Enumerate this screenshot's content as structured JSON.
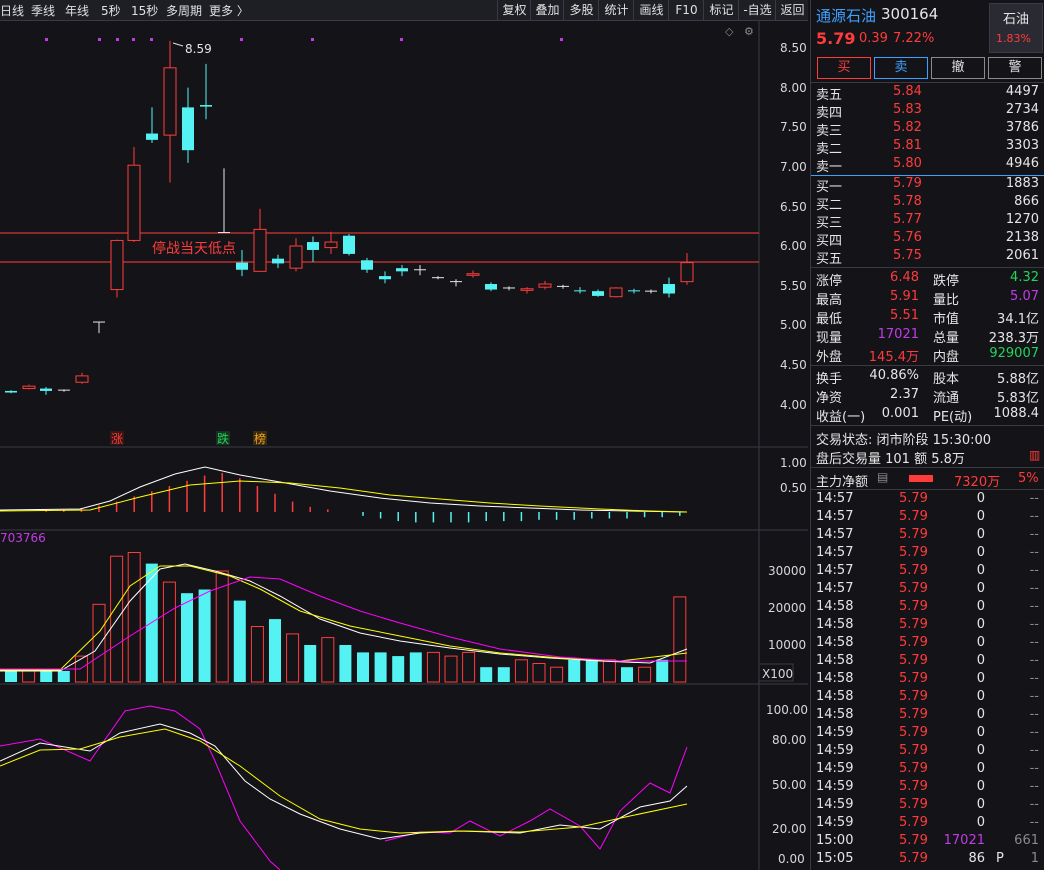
{
  "toolbar": {
    "periods": [
      "日线",
      "季线",
      "年线",
      "5秒",
      "15秒",
      "多周期",
      "更多 〉"
    ],
    "buttons": [
      "复权",
      "叠加",
      "多股",
      "统计",
      "画线",
      "F10",
      "标记",
      "-自选",
      "返回"
    ]
  },
  "main_chart": {
    "price_ticks": [
      "8.50",
      "8.00",
      "7.50",
      "7.00",
      "6.50",
      "6.00",
      "5.50",
      "5.00",
      "4.50",
      "4.00"
    ],
    "high_label": "8.59",
    "annotation": "停战当天低点",
    "event_markers": [
      "涨",
      "跌",
      "榜"
    ]
  },
  "indicator1": {
    "ticks": [
      "1.00",
      "0.50"
    ]
  },
  "volume_panel": {
    "header_value": "703766",
    "ticks": [
      "30000",
      "20000",
      "10000"
    ],
    "unit": "X100"
  },
  "indicator3": {
    "ticks": [
      "100.00",
      "80.00",
      "50.00",
      "20.00",
      "0.00"
    ]
  },
  "quote": {
    "name": "通源石油",
    "code": "300164",
    "sector": "石油",
    "sector_change": "1.83%",
    "price": "5.79",
    "change": "0.39",
    "change_pct": "7.22%",
    "trade_buttons": [
      "买",
      "卖",
      "撤",
      "警"
    ],
    "asks": [
      {
        "label": "卖五",
        "price": "5.84",
        "vol": "4497"
      },
      {
        "label": "卖四",
        "price": "5.83",
        "vol": "2734"
      },
      {
        "label": "卖三",
        "price": "5.82",
        "vol": "3786"
      },
      {
        "label": "卖二",
        "price": "5.81",
        "vol": "3303"
      },
      {
        "label": "卖一",
        "price": "5.80",
        "vol": "4946"
      }
    ],
    "bids": [
      {
        "label": "买一",
        "price": "5.79",
        "vol": "1883"
      },
      {
        "label": "买二",
        "price": "5.78",
        "vol": "866"
      },
      {
        "label": "买三",
        "price": "5.77",
        "vol": "1270"
      },
      {
        "label": "买四",
        "price": "5.76",
        "vol": "2138"
      },
      {
        "label": "买五",
        "price": "5.75",
        "vol": "2061"
      }
    ],
    "stats": [
      {
        "l1": "涨停",
        "v1": "6.48",
        "c1": "red",
        "l2": "跌停",
        "v2": "4.32",
        "c2": "grn"
      },
      {
        "l1": "最高",
        "v1": "5.91",
        "c1": "red",
        "l2": "量比",
        "v2": "5.07",
        "c2": "pur"
      },
      {
        "l1": "最低",
        "v1": "5.51",
        "c1": "red",
        "l2": "市值",
        "v2": "34.1亿",
        "c2": "wht"
      },
      {
        "l1": "现量",
        "v1": "17021",
        "c1": "pur",
        "l2": "总量",
        "v2": "238.3万",
        "c2": "wht"
      },
      {
        "l1": "外盘",
        "v1": "145.4万",
        "c1": "red",
        "l2": "内盘",
        "v2": "929007",
        "c2": "grn"
      }
    ],
    "stats2": [
      {
        "l1": "换手",
        "v1": "40.86%",
        "l2": "股本",
        "v2": "5.88亿"
      },
      {
        "l1": "净资",
        "v1": "2.37",
        "l2": "流通",
        "v2": "5.83亿"
      },
      {
        "l1": "收益(一)",
        "v1": "0.001",
        "l2": "PE(动)",
        "v2": "1088.4"
      }
    ],
    "status_line": "交易状态: 闭市阶段 15:30:00",
    "after_hours": "盘后交易量 101 额 5.8万",
    "main_flow_label": "主力净额",
    "main_flow_value": "7320万",
    "main_flow_pct": "5%"
  },
  "ticks": [
    {
      "t": "14:57",
      "p": "5.79",
      "v": "0",
      "f": "--"
    },
    {
      "t": "14:57",
      "p": "5.79",
      "v": "0",
      "f": "--"
    },
    {
      "t": "14:57",
      "p": "5.79",
      "v": "0",
      "f": "--"
    },
    {
      "t": "14:57",
      "p": "5.79",
      "v": "0",
      "f": "--"
    },
    {
      "t": "14:57",
      "p": "5.79",
      "v": "0",
      "f": "--"
    },
    {
      "t": "14:57",
      "p": "5.79",
      "v": "0",
      "f": "--"
    },
    {
      "t": "14:58",
      "p": "5.79",
      "v": "0",
      "f": "--"
    },
    {
      "t": "14:58",
      "p": "5.79",
      "v": "0",
      "f": "--"
    },
    {
      "t": "14:58",
      "p": "5.79",
      "v": "0",
      "f": "--"
    },
    {
      "t": "14:58",
      "p": "5.79",
      "v": "0",
      "f": "--"
    },
    {
      "t": "14:58",
      "p": "5.79",
      "v": "0",
      "f": "--"
    },
    {
      "t": "14:58",
      "p": "5.79",
      "v": "0",
      "f": "--"
    },
    {
      "t": "14:58",
      "p": "5.79",
      "v": "0",
      "f": "--"
    },
    {
      "t": "14:59",
      "p": "5.79",
      "v": "0",
      "f": "--"
    },
    {
      "t": "14:59",
      "p": "5.79",
      "v": "0",
      "f": "--"
    },
    {
      "t": "14:59",
      "p": "5.79",
      "v": "0",
      "f": "--"
    },
    {
      "t": "14:59",
      "p": "5.79",
      "v": "0",
      "f": "--"
    },
    {
      "t": "14:59",
      "p": "5.79",
      "v": "0",
      "f": "--"
    },
    {
      "t": "14:59",
      "p": "5.79",
      "v": "0",
      "f": "--"
    },
    {
      "t": "15:00",
      "p": "5.79",
      "v": "17021",
      "f": "661"
    },
    {
      "t": "15:05",
      "p": "5.79",
      "v": "86",
      "f": "1"
    }
  ],
  "tick_extra_last": "P",
  "colors": {
    "up": "#ff3b3b",
    "down": "#54f2f2",
    "ma1": "#ffffff",
    "ma2": "#ffff00",
    "ma3": "#ff00ff",
    "bg": "#141418",
    "grid": "#3a3b42"
  }
}
